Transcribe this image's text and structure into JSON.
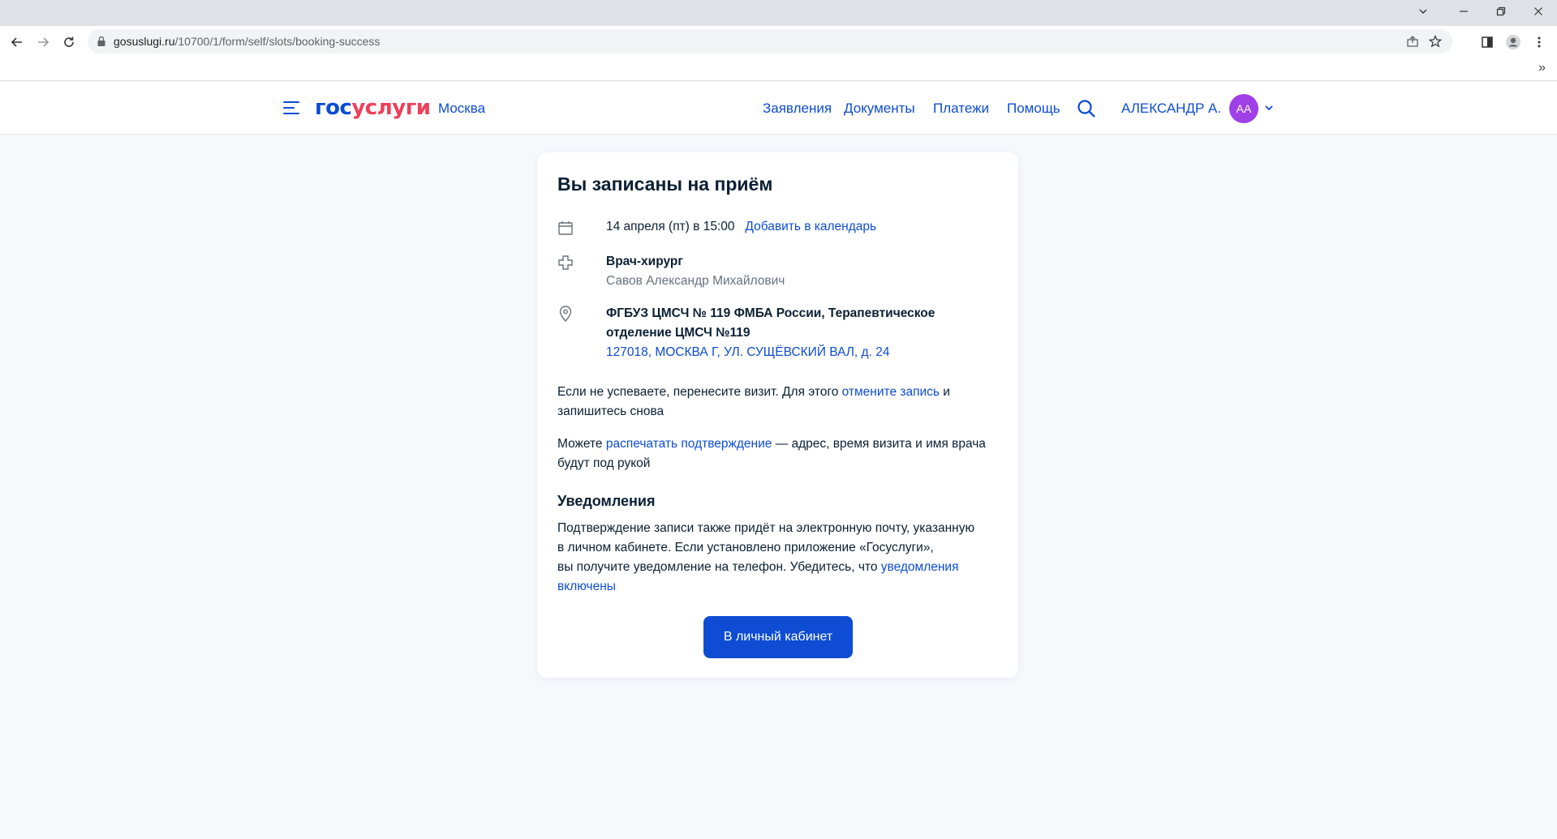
{
  "browser": {
    "url_domain": "gosuslugi.ru",
    "url_path": "/10700/1/form/self/slots/booking-success",
    "bookmarks_more": "»"
  },
  "header": {
    "logo_part1": "гос",
    "logo_part2": "услуги",
    "city": "Москва",
    "nav": [
      "Заявления",
      "Документы",
      "Платежи",
      "Помощь"
    ],
    "user_name": "АЛЕКСАНДР А.",
    "avatar_initials": "АА",
    "colors": {
      "brand_blue": "#0d4cd3",
      "brand_red": "#ee3f58",
      "avatar": "#a040e8"
    }
  },
  "card": {
    "title": "Вы записаны на приём",
    "date_text": "14 апреля (пт) в 15:00",
    "add_calendar_link": "Добавить в календарь",
    "doctor_specialty": "Врач-хирург",
    "doctor_name": "Савов Александр Михайлович",
    "clinic_line1": "ФГБУЗ ЦМСЧ № 119 ФМБА России, Терапевтическое",
    "clinic_line2": "отделение ЦМСЧ №119",
    "clinic_address": "127018, МОСКВА Г, УЛ. СУЩЁВСКИЙ ВАЛ, д. 24",
    "reschedule_text_1": "Если не успеваете, перенесите визит. Для этого ",
    "reschedule_link": "отмените запись",
    "reschedule_text_2": " и",
    "reschedule_text_3": "запишитесь снова",
    "print_text_1": "Можете ",
    "print_link": "распечатать подтверждение",
    "print_text_2": " — адрес, время визита и имя врача",
    "print_text_3": "будут под рукой",
    "notifications_title": "Уведомления",
    "notif_line1": "Подтверждение записи также придёт на электронную почту, указанную",
    "notif_line2": "в личном кабинете. Если установлено приложение «Госуслуги»,",
    "notif_line3": "вы получите уведомление на телефон. Убедитесь, что ",
    "notif_link1": "уведомления",
    "notif_link2": "включены",
    "button_label": "В личный кабинет"
  }
}
